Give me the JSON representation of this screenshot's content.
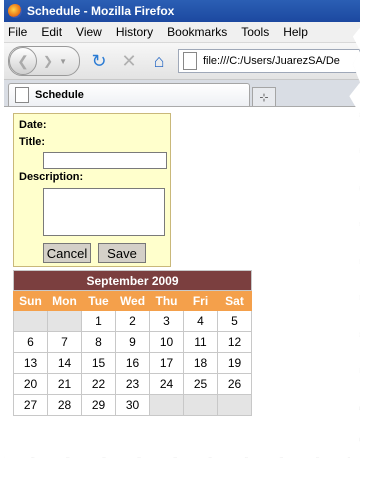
{
  "window": {
    "title": "Schedule - Mozilla Firefox"
  },
  "menu": [
    "File",
    "Edit",
    "View",
    "History",
    "Bookmarks",
    "Tools",
    "Help"
  ],
  "navbar": {
    "url": "file:///C:/Users/JuarezSA/De"
  },
  "tab": {
    "label": "Schedule",
    "newtab_glyph": "⊹"
  },
  "form": {
    "date_label": "Date:",
    "title_label": "Title:",
    "title_value": "",
    "description_label": "Description:",
    "description_value": "",
    "cancel_label": "Cancel",
    "save_label": "Save"
  },
  "calendar": {
    "header": "September 2009",
    "days": [
      "Sun",
      "Mon",
      "Tue",
      "Wed",
      "Thu",
      "Fri",
      "Sat"
    ],
    "weeks": [
      [
        "",
        "",
        "1",
        "2",
        "3",
        "4",
        "5"
      ],
      [
        "6",
        "7",
        "8",
        "9",
        "10",
        "11",
        "12"
      ],
      [
        "13",
        "14",
        "15",
        "16",
        "17",
        "18",
        "19"
      ],
      [
        "20",
        "21",
        "22",
        "23",
        "24",
        "25",
        "26"
      ],
      [
        "27",
        "28",
        "29",
        "30",
        "",
        "",
        ""
      ]
    ],
    "colors": {
      "header_bg": "#7b3f3f",
      "day_header_bg": "#f4a04b",
      "empty_bg": "#e4e4e4"
    }
  }
}
